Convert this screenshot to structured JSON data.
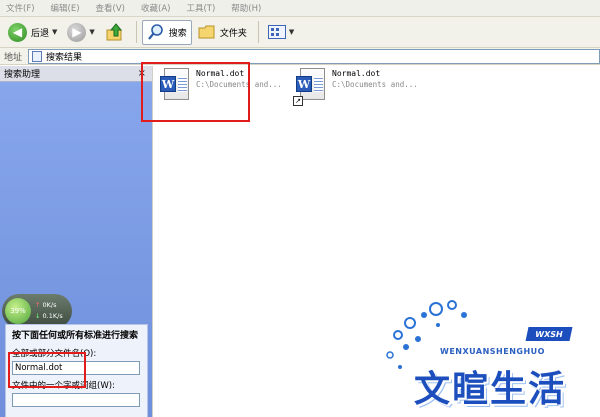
{
  "menubar": {
    "items": [
      "文件(F)",
      "编辑(E)",
      "查看(V)",
      "收藏(A)",
      "工具(T)",
      "帮助(H)"
    ]
  },
  "toolbar": {
    "back_label": "后退",
    "search_label": "搜索",
    "folders_label": "文件夹"
  },
  "addressbar": {
    "label": "地址",
    "value": "搜索结果"
  },
  "search_assistant": {
    "header": "搜索助理",
    "close_glyph": "×",
    "speed": {
      "percent": "39%",
      "up": "0K/s",
      "down": "0.1K/s"
    },
    "panel_title": "按下面任何或所有标准进行搜索",
    "filename_label": "全部或部分文件名(O):",
    "filename_value": "Normal.dot",
    "phrase_label": "文件中的一个字或词组(W):"
  },
  "results": [
    {
      "name": "Normal.dot",
      "path": "C:\\Documents and...",
      "shortcut": false
    },
    {
      "name": "Normal.dot",
      "path": "C:\\Documents and...",
      "shortcut": true
    }
  ],
  "watermark": {
    "badge": "WXSH",
    "pinyin": "WENXUANSHENGHUO",
    "title": "文暄生活"
  },
  "colors": {
    "left_pane": "#7b9ce6",
    "highlight_frame": "#e21b1b",
    "logo_blue": "#1c4fbd"
  }
}
